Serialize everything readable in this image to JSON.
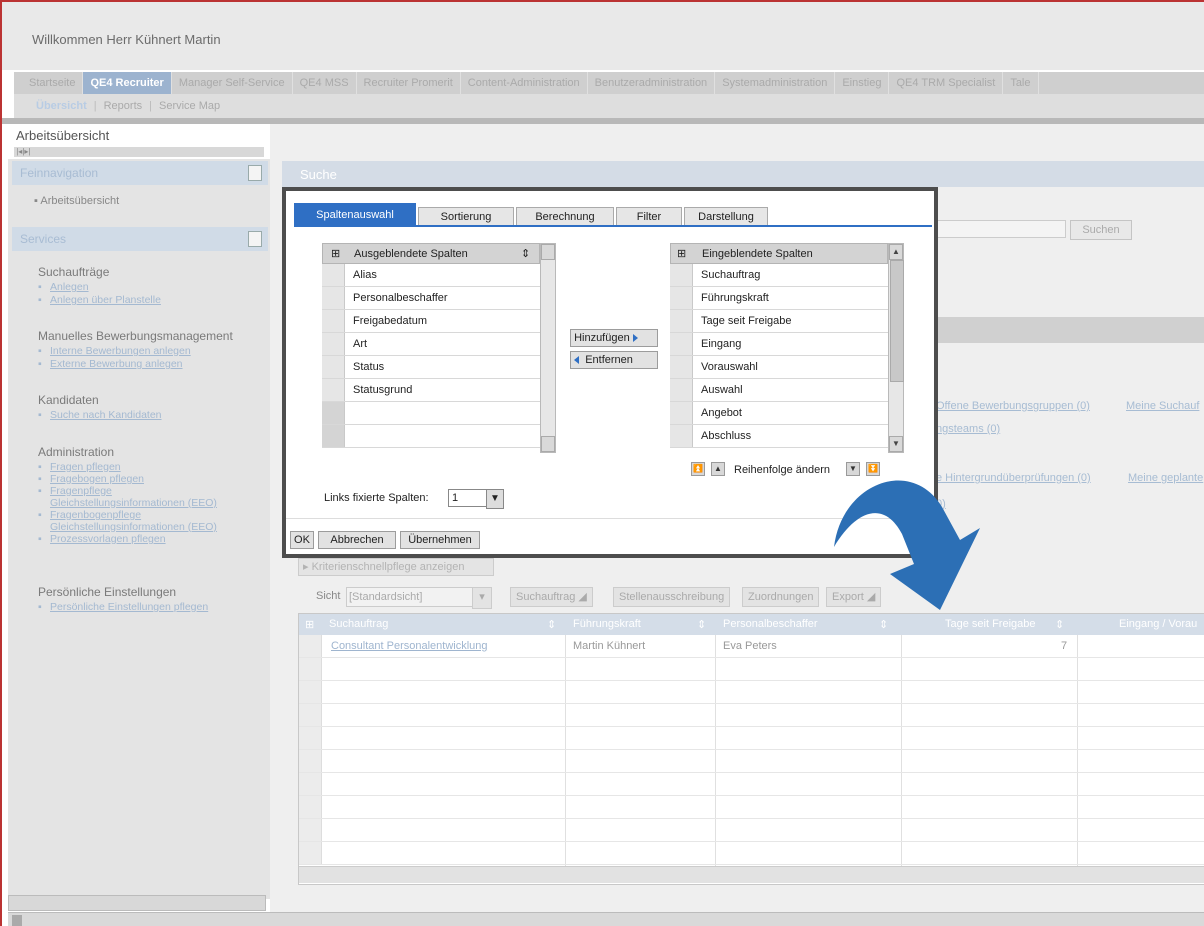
{
  "header": {
    "welcome": "Willkommen Herr Kühnert Martin"
  },
  "top_tabs": [
    "Startseite",
    "QE4 Recruiter",
    "Manager Self-Service",
    "QE4 MSS",
    "Recruiter Promerit",
    "Content-Administration",
    "Benutzeradministration",
    "Systemadministration",
    "Einstieg",
    "QE4 TRM Specialist",
    "Tale"
  ],
  "top_tabs_active": "QE4 Recruiter",
  "sub_nav": {
    "active": "Übersicht",
    "items": [
      "Reports",
      "Service Map"
    ]
  },
  "work_header": "Arbeitsübersicht",
  "left_panel": {
    "feinnavigation": "Feinnavigation",
    "arbeit_item": "Arbeitsübersicht",
    "services": "Services",
    "sections": [
      {
        "title": "Suchaufträge",
        "links": [
          "Anlegen",
          "Anlegen über Planstelle"
        ]
      },
      {
        "title": "Manuelles Bewerbungsmanagement",
        "links": [
          "Interne Bewerbungen anlegen",
          "Externe Bewerbung anlegen"
        ]
      },
      {
        "title": "Kandidaten",
        "links": [
          "Suche nach Kandidaten"
        ]
      },
      {
        "title": "Administration",
        "links": [
          "Fragen pflegen",
          "Fragebogen pflegen",
          "Fragenpflege",
          "Gleichstellungsinformationen (EEO)",
          "Fragenbogenpflege",
          "Gleichstellungsinformationen (EEO)",
          "Prozessvorlagen pflegen"
        ]
      },
      {
        "title": "Persönliche Einstellungen",
        "links": [
          "Persönliche Einstellungen pflegen"
        ]
      }
    ]
  },
  "search": {
    "title": "Suche",
    "button": "Suchen",
    "link1": "Offene Bewerbungsgruppen (0)",
    "link2": "Meine Suchauf",
    "link3": "ngsteams (0)",
    "link4": "e Hintergrundüberprüfungen (0)",
    "link5": "Meine geplante",
    "link6": "0)",
    "kriterien_button": "Kriterienschnellpflege anzeigen"
  },
  "toolbar": {
    "sicht_label": "Sicht",
    "sicht_value": "[Standardsicht]",
    "btn_suchauftrag": "Suchauftrag",
    "btn_stelle": "Stellenausschreibung",
    "btn_zuordnungen": "Zuordnungen",
    "btn_export": "Export"
  },
  "grid": {
    "columns": [
      "Suchauftrag",
      "Führungskraft",
      "Personalbeschaffer",
      "Tage seit Freigabe",
      "Eingang / Vorau"
    ],
    "rows": [
      {
        "suchauftrag": "Consultant Personalentwicklung",
        "fuehrungskraft": "Martin Kühnert",
        "personalbeschaffer": "Eva Peters",
        "tage": "7"
      }
    ]
  },
  "modal": {
    "tabs": [
      "Spaltenauswahl",
      "Sortierung",
      "Berechnung",
      "Filter",
      "Darstellung"
    ],
    "active_tab": "Spaltenauswahl",
    "hidden_header": "Ausgeblendete Spalten",
    "hidden_columns": [
      "Alias",
      "Personalbeschaffer",
      "Freigabedatum",
      "Art",
      "Status",
      "Statusgrund",
      "",
      ""
    ],
    "shown_header": "Eingeblendete Spalten",
    "shown_columns": [
      "Suchauftrag",
      "Führungskraft",
      "Tage seit Freigabe",
      "Eingang",
      "Vorauswahl",
      "Auswahl",
      "Angebot",
      "Abschluss"
    ],
    "add_button": "Hinzufügen",
    "remove_button": "Entfernen",
    "reorder_label": "Reihenfolge ändern",
    "fixed_label": "Links fixierte Spalten:",
    "fixed_value": "1",
    "ok": "OK",
    "cancel": "Abbrechen",
    "apply": "Übernehmen"
  },
  "colors": {
    "accent": "#2f6fc4",
    "arrow": "#2c6fb5",
    "frame": "#b33333"
  }
}
